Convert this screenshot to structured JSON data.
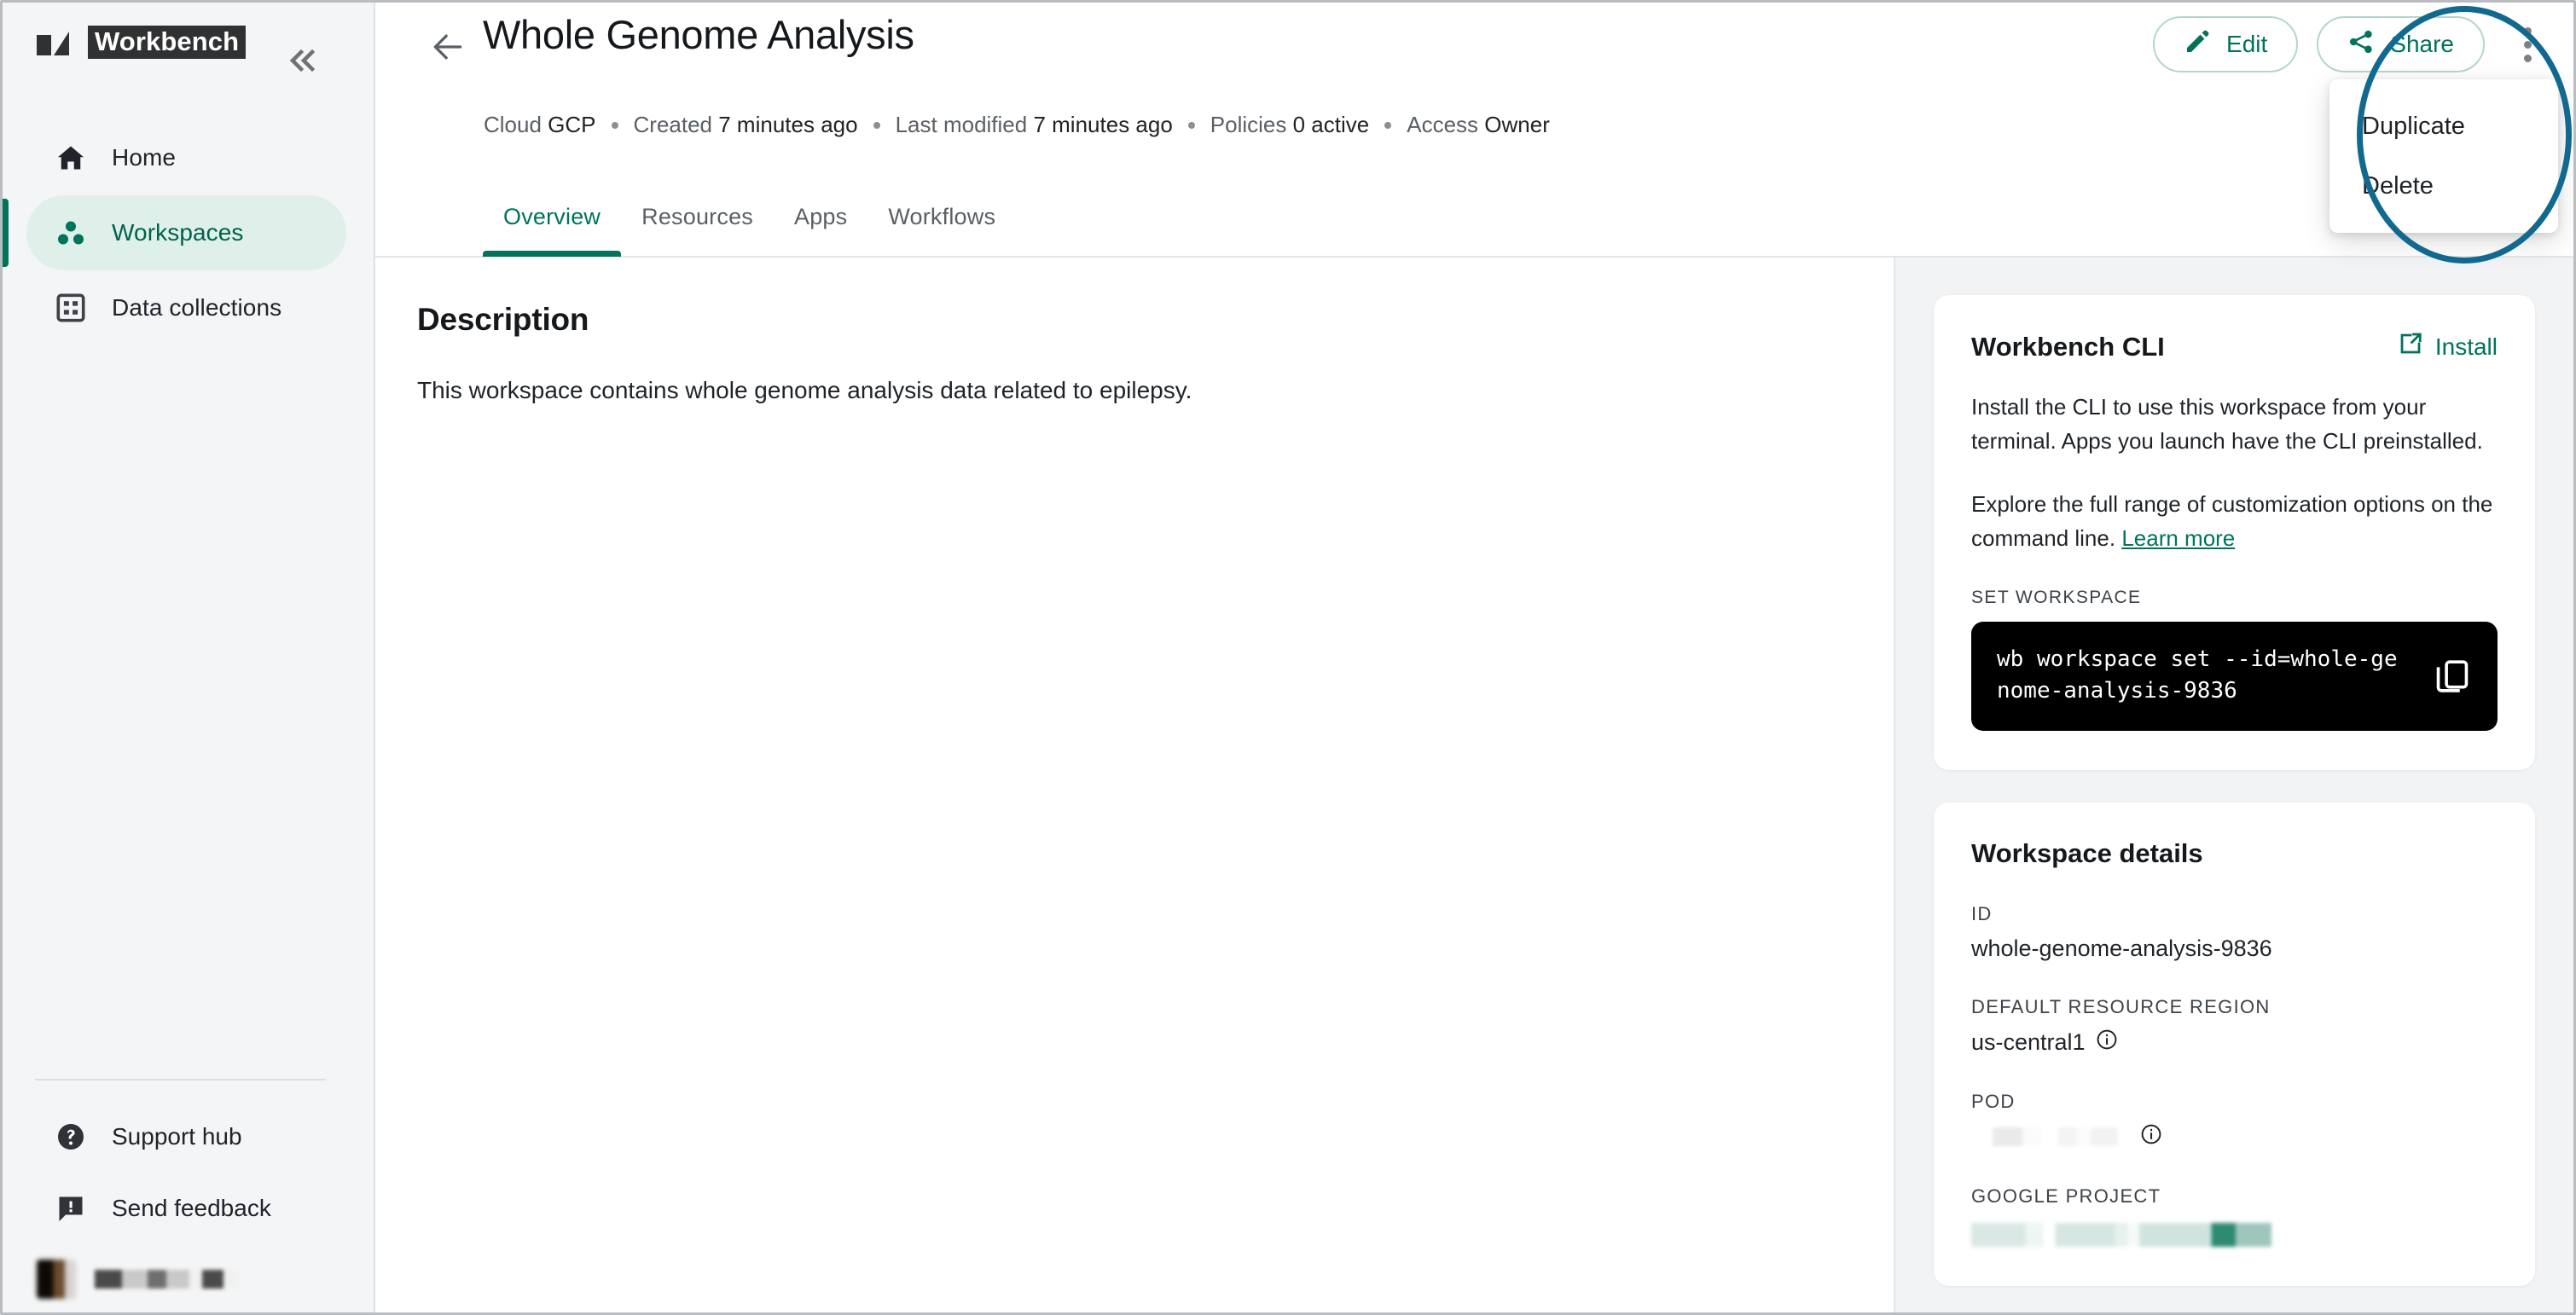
{
  "brand": {
    "name": "Workbench",
    "logo_icon": "workbench-logo-icon",
    "collapse_icon": "chevrons-left-icon"
  },
  "sidebar": {
    "items": [
      {
        "label": "Home",
        "icon": "home-icon",
        "active": false
      },
      {
        "label": "Workspaces",
        "icon": "workspaces-dots-icon",
        "active": true
      },
      {
        "label": "Data collections",
        "icon": "grid-table-icon",
        "active": false
      }
    ],
    "footer_items": [
      {
        "label": "Support hub",
        "icon": "help-circle-icon"
      },
      {
        "label": "Send feedback",
        "icon": "feedback-chat-icon"
      }
    ],
    "user": {
      "name_redacted": true,
      "avatar_redacted": true
    }
  },
  "header": {
    "back_icon": "arrow-left-icon",
    "title": "Whole Genome Analysis",
    "meta": [
      {
        "label": "Cloud",
        "value": "GCP"
      },
      {
        "label": "Created",
        "value": "7 minutes ago"
      },
      {
        "label": "Last modified",
        "value": "7 minutes ago"
      },
      {
        "label": "Policies",
        "value": "0 active"
      },
      {
        "label": "Access",
        "value": "Owner"
      }
    ],
    "tabs": [
      {
        "label": "Overview",
        "active": true
      },
      {
        "label": "Resources",
        "active": false
      },
      {
        "label": "Apps",
        "active": false
      },
      {
        "label": "Workflows",
        "active": false
      }
    ],
    "actions": {
      "edit_label": "Edit",
      "edit_icon": "pencil-icon",
      "share_label": "Share",
      "share_icon": "share-nodes-icon",
      "more_icon": "kebab-menu-icon"
    },
    "menu": {
      "open": true,
      "items": [
        {
          "label": "Duplicate"
        },
        {
          "label": "Delete"
        }
      ]
    },
    "annotation": {
      "shape": "ellipse",
      "color": "#12698f"
    }
  },
  "main": {
    "description_heading": "Description",
    "description_text": "This workspace contains whole genome analysis data related to epilepsy."
  },
  "right_panel": {
    "cli_card": {
      "title": "Workbench CLI",
      "install_label": "Install",
      "install_icon": "external-link-icon",
      "paragraph_1": "Install the CLI to use this workspace from your terminal. Apps you launch have the CLI preinstalled.",
      "paragraph_2_prefix": "Explore the full range of customization options on the command line. ",
      "paragraph_2_link": "Learn more",
      "set_workspace_label": "SET WORKSPACE",
      "command": "wb workspace set --id=whole-genome-analysis-9836",
      "copy_icon": "copy-icon"
    },
    "details_card": {
      "title": "Workspace details",
      "fields": [
        {
          "label": "ID",
          "value": "whole-genome-analysis-9836",
          "redacted": false,
          "info": false
        },
        {
          "label": "DEFAULT RESOURCE REGION",
          "value": "us-central1",
          "redacted": false,
          "info": true
        },
        {
          "label": "POD",
          "value": "",
          "redacted": true,
          "info": true
        },
        {
          "label": "GOOGLE PROJECT",
          "value": "",
          "redacted": true,
          "info": false
        }
      ]
    }
  },
  "colors": {
    "accent_teal": "#00735a",
    "accent_teal_light": "#dff0eb",
    "annotation_blue": "#12698f",
    "panel_bg": "#f1f3f4",
    "sidebar_bg": "#f3f5f6",
    "terminal_bg": "#000000"
  }
}
